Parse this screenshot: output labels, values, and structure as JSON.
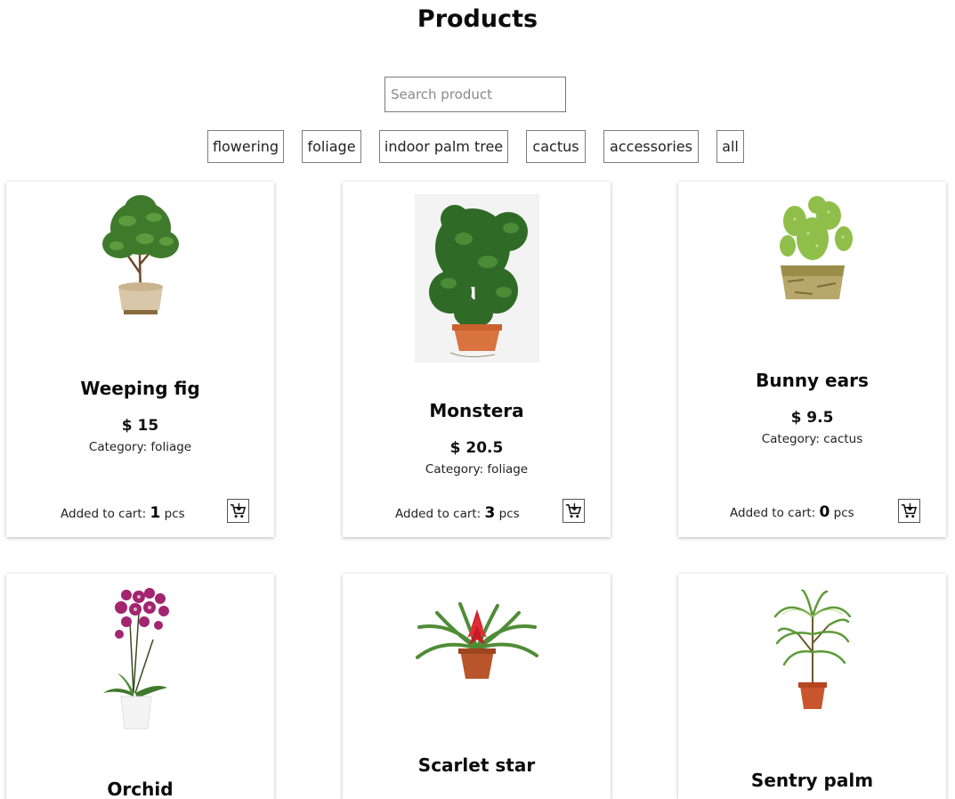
{
  "page": {
    "title": "Products"
  },
  "search": {
    "placeholder": "Search product",
    "value": ""
  },
  "filters": [
    "flowering",
    "foliage",
    "indoor palm tree",
    "cactus",
    "accessories",
    "all"
  ],
  "cart": {
    "prefix": "Added to cart:",
    "unit": "pcs",
    "icon": "add-to-cart-icon"
  },
  "products": [
    {
      "name": "Weeping fig",
      "price": "$ 15",
      "category": "Category: foliage",
      "cart_count": "1"
    },
    {
      "name": "Monstera",
      "price": "$ 20.5",
      "category": "Category: foliage",
      "cart_count": "3"
    },
    {
      "name": "Bunny ears",
      "price": "$ 9.5",
      "category": "Category: cactus",
      "cart_count": "0"
    },
    {
      "name": "Orchid"
    },
    {
      "name": "Scarlet star"
    },
    {
      "name": "Sentry palm"
    }
  ],
  "colors": {
    "border": "#7d7d7d",
    "leaf": "#3f7a2c",
    "terracotta": "#d9733f",
    "orchid": "#a2256f"
  }
}
